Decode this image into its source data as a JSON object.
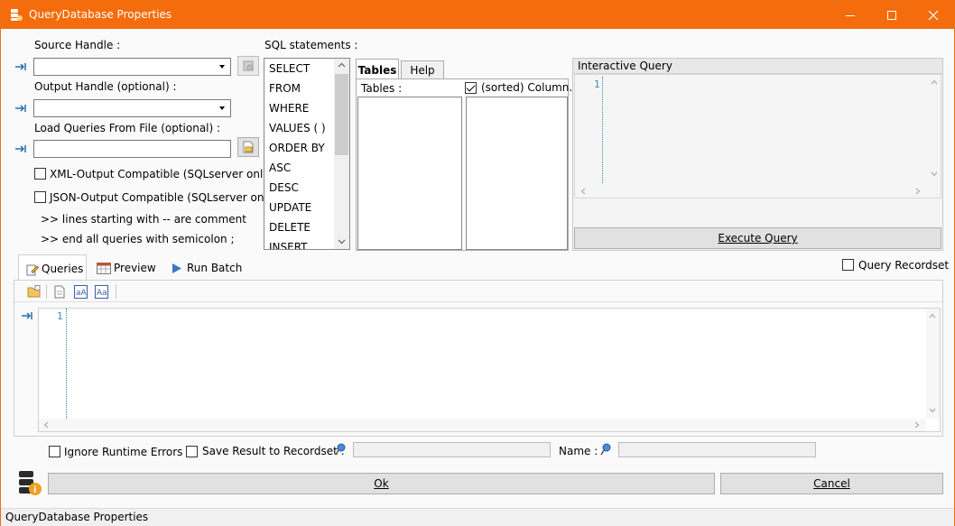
{
  "window": {
    "title": "QueryDatabase Properties"
  },
  "labels": {
    "source_handle": "Source Handle :",
    "output_handle": "Output Handle (optional) :",
    "load_queries": "Load Queries From File (optional) :",
    "sql_statements": "SQL statements :"
  },
  "checkboxes": {
    "xml_output": {
      "label": "XML-Output Compatible (SQLserver only)",
      "checked": false
    },
    "json_output": {
      "label": "JSON-Output Compatible (SQLserver only)",
      "checked": false
    },
    "sorted_columns": {
      "label": "(sorted) Column...",
      "checked": true
    },
    "query_recordset": {
      "label": "Query Recordset",
      "checked": false
    },
    "ignore_errors": {
      "label": "Ignore Runtime Errors",
      "checked": false
    },
    "save_result": {
      "label": "Save Result to Recordset :",
      "checked": false
    }
  },
  "notes": [
    ">> lines starting with -- are comment",
    ">> end all queries with semicolon ;"
  ],
  "sql_keywords": [
    "SELECT",
    "FROM",
    "WHERE",
    "VALUES ( )",
    "ORDER BY",
    "ASC",
    "DESC",
    "UPDATE",
    "DELETE",
    "INSERT"
  ],
  "schema_tabs": [
    {
      "label": "Tables",
      "active": true
    },
    {
      "label": "Help",
      "active": false
    }
  ],
  "tables_label": "Tables :",
  "interactive_query": {
    "title": "Interactive Query",
    "line": "1",
    "execute_label": "Execute Query"
  },
  "bottom_tabs": [
    {
      "label": "Queries",
      "active": true,
      "icon": "queries-icon"
    },
    {
      "label": "Preview",
      "active": false,
      "icon": "preview-icon"
    },
    {
      "label": "Run Batch",
      "active": false,
      "icon": "play-icon"
    }
  ],
  "editor": {
    "line": "1"
  },
  "name_label": "Name :",
  "buttons": {
    "ok": "Ok",
    "cancel": "Cancel"
  },
  "status": "QueryDatabase Properties",
  "colors": {
    "titlebar": "#f56c0c",
    "accent": "#2b91af"
  }
}
